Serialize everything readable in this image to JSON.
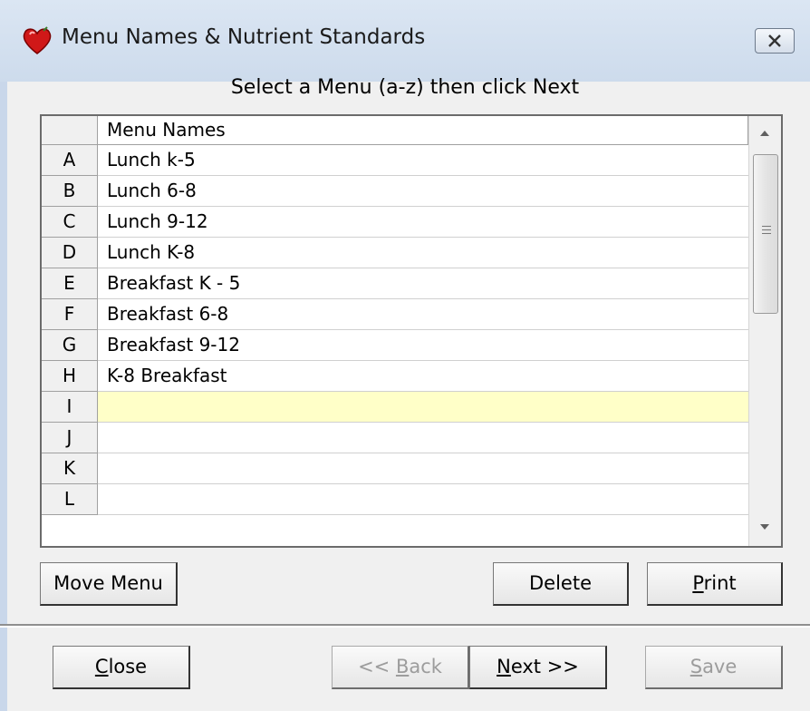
{
  "window": {
    "title": "Menu Names & Nutrient Standards",
    "close_label": "close"
  },
  "prompt": "Select a Menu (a-z) then click Next",
  "grid": {
    "column_header": "Menu Names",
    "rows": [
      {
        "letter": "A",
        "name": "Lunch k-5"
      },
      {
        "letter": "B",
        "name": "Lunch 6-8"
      },
      {
        "letter": "C",
        "name": "Lunch 9-12"
      },
      {
        "letter": "D",
        "name": "Lunch K-8"
      },
      {
        "letter": "E",
        "name": "Breakfast K - 5"
      },
      {
        "letter": "F",
        "name": "Breakfast 6-8"
      },
      {
        "letter": "G",
        "name": "Breakfast 9-12"
      },
      {
        "letter": "H",
        "name": "K-8 Breakfast"
      },
      {
        "letter": "I",
        "name": ""
      },
      {
        "letter": "J",
        "name": ""
      },
      {
        "letter": "K",
        "name": ""
      },
      {
        "letter": "L",
        "name": ""
      }
    ],
    "selected_row": "I",
    "selected_color": "#ffffc8"
  },
  "buttons": {
    "move_menu": "Move Menu",
    "delete": "Delete",
    "print": {
      "mnemonic": "P",
      "rest": "rint"
    },
    "close": {
      "mnemonic": "C",
      "rest": "lose"
    },
    "back": {
      "prefix": "<< ",
      "mnemonic": "B",
      "rest": "ack"
    },
    "next": {
      "mnemonic": "N",
      "rest": "ext >>"
    },
    "save": {
      "mnemonic": "S",
      "rest": "ave"
    }
  },
  "icons": {
    "app": "heart-icon",
    "close": "close-icon"
  }
}
